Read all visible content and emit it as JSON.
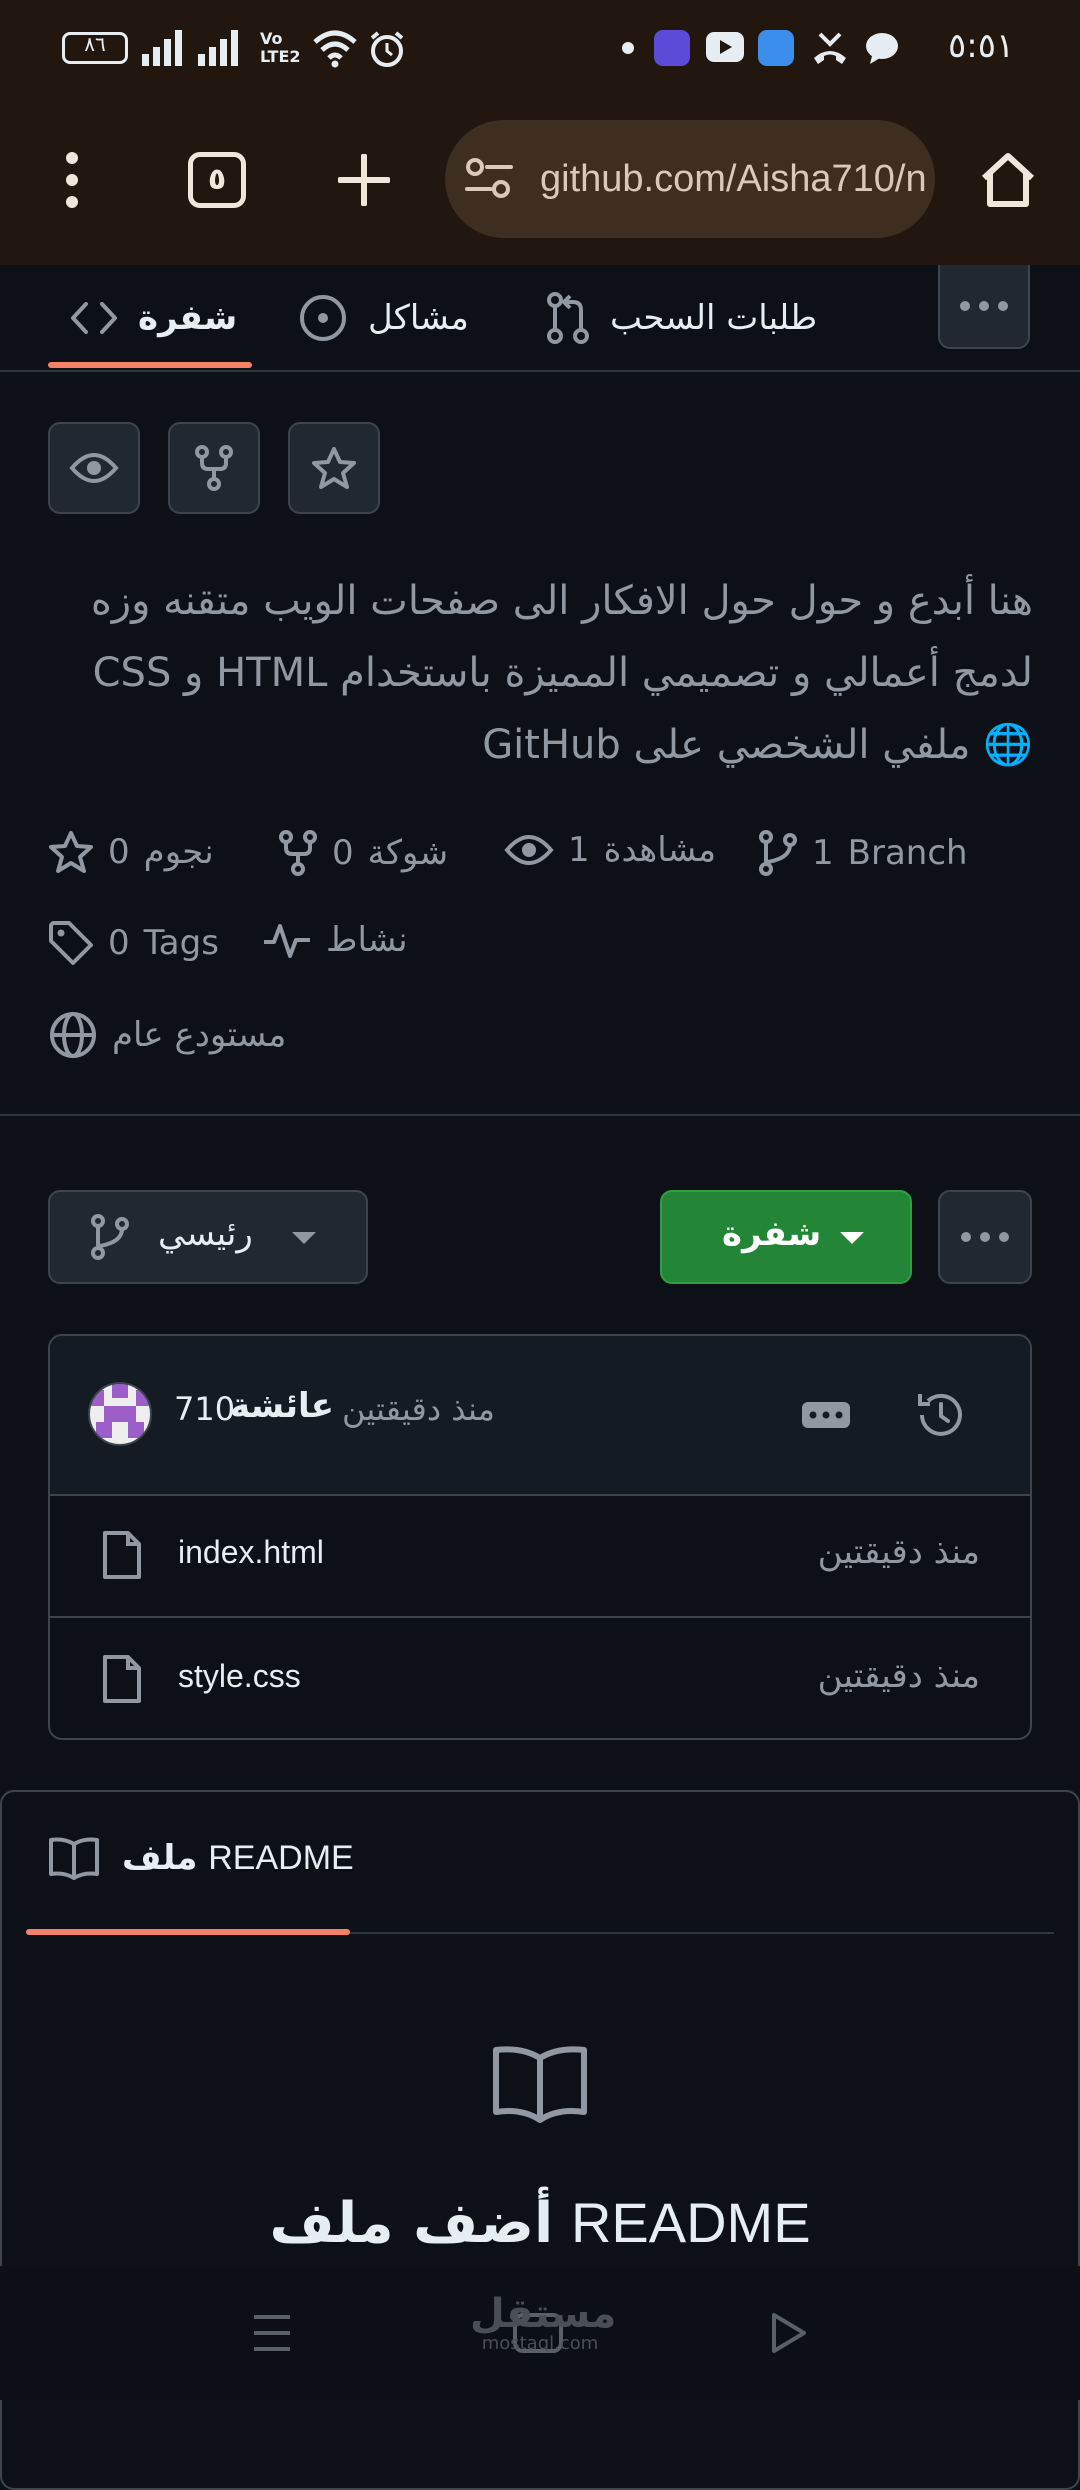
{
  "status_bar": {
    "time": "٥:٥١",
    "battery": "٨٦"
  },
  "browser": {
    "url": "github.com/Aisha710/n",
    "tab_count": "٥"
  },
  "repo_tabs": {
    "code": "شفرة",
    "issues": "مشاكل",
    "pull_requests": "طلبات السحب"
  },
  "repo": {
    "description": "هنا أبدع و حول حول الافكار الى صفحات الويب متقنه وزه لدمج أعمالي و تصميمي المميزة باستخدام HTML و CSS 🌐 ملفي الشخصي على GitHub",
    "stats": {
      "stars_count": "0",
      "stars_label": "نجوم",
      "forks_count": "0",
      "forks_label": "شوكة",
      "watch_count": "1",
      "watch_label": "مشاهدة",
      "branch_count": "1",
      "branch_label": "Branch",
      "tags_count": "0",
      "tags_label": "Tags",
      "activity_label": "نشاط",
      "visibility_label": "مستودع عام"
    }
  },
  "controls": {
    "branch_label": "رئيسي",
    "code_label": "شفرة"
  },
  "commit": {
    "user_handle": "710",
    "user_name": "عائشة",
    "time": "منذ دقيقتين"
  },
  "files": [
    {
      "name": "index.html",
      "time": "منذ دقيقتين"
    },
    {
      "name": "style.css",
      "time": "منذ دقيقتين"
    }
  ],
  "readme": {
    "tab_word": "ملف",
    "tab_name": "README",
    "title_word": "أضف ملف",
    "title_name": "README"
  },
  "watermark": {
    "brand": "مستقل",
    "domain": "mostaql.com"
  },
  "colors": {
    "background": "#0d1117",
    "accent_underline": "#f78166",
    "code_button": "#238636"
  }
}
